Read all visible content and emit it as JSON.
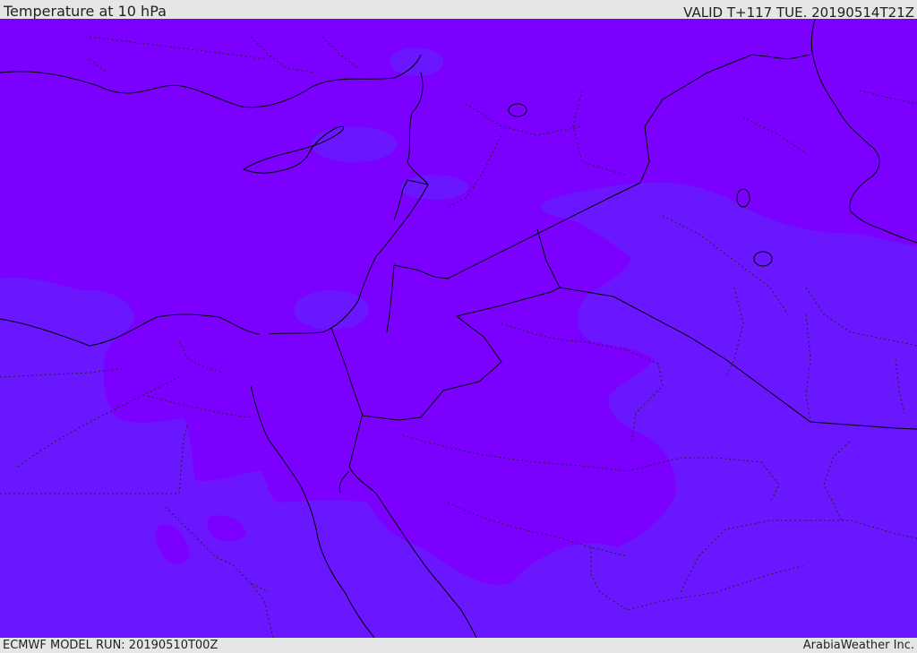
{
  "header": {
    "title": "Temperature at 10 hPa",
    "valid_time": "VALID T+117 TUE. 20190514T21Z"
  },
  "footer": {
    "model_run": "ECMWF MODEL RUN: 20190510T00Z",
    "credit": "ArabiaWeather Inc."
  },
  "map": {
    "variable": "temperature",
    "level": "10 hPa",
    "fill_colors": {
      "warm_violet": "#7b00ff",
      "cool_indigo": "#6a16ff",
      "coastline": "#000000",
      "border": "#000000"
    }
  }
}
